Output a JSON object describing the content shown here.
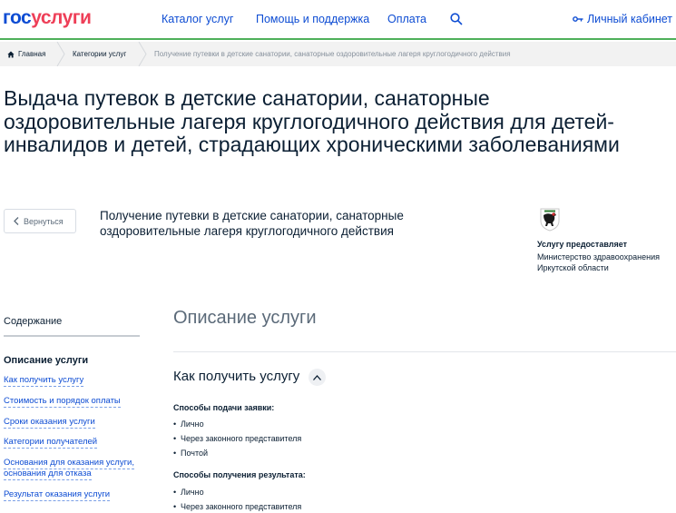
{
  "header": {
    "logo_part1": "гос",
    "logo_part2": "услуги",
    "nav": [
      "Каталог услуг",
      "Помощь и поддержка",
      "Оплата"
    ],
    "cabinet_label": "Личный кабинет"
  },
  "breadcrumb": {
    "home": "Главная",
    "category": "Категории услуг",
    "current": "Получение путевки в детские санатории, санаторные оздоровительные лагеря круглогодичного действия"
  },
  "page_title": "Выдача путевок в детские санатории, санаторные оздоровительные лагеря круглогодичного действия для детей-инвалидов и детей, страдающих хроническими заболеваниями",
  "back_label": "Вернуться",
  "subtitle": "Получение путевки в детские санатории, санаторные оздоровительные лагеря круглогодичного действия",
  "provider": {
    "label": "Услугу предоставляет",
    "name": "Министерство здравоохранения Иркутской области"
  },
  "toc": {
    "heading": "Содержание",
    "active": "Описание услуги",
    "links": [
      "Как получить услугу",
      "Стоимость и порядок оплаты",
      "Сроки оказания услуги",
      "Категории получателей",
      "Основания для оказания услуги,",
      "основания для отказа",
      "Результат оказания услуги"
    ]
  },
  "main": {
    "section_title": "Описание услуги",
    "how_title": "Как получить услугу",
    "submit_label": "Способы подачи заявки:",
    "submit_methods": [
      "Лично",
      "Через законного представителя",
      "Почтой"
    ],
    "result_label": "Способы получения результата:",
    "result_methods": [
      "Лично",
      "Через законного представителя"
    ]
  },
  "colors": {
    "brand_blue": "#0d4cd3",
    "brand_red": "#ee3f58",
    "accent_green": "#4eb05a"
  },
  "icons": [
    "search-icon",
    "key-icon",
    "home-icon",
    "chevron-left-icon",
    "chevron-up-icon",
    "coat-of-arms-icon"
  ]
}
